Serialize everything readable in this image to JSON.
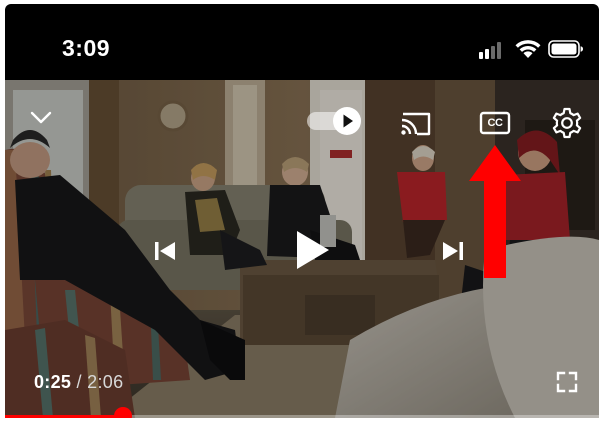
{
  "status_bar": {
    "time": "3:09",
    "signal_icon": "cellular-signal-icon",
    "wifi_icon": "wifi-icon",
    "battery_icon": "battery-icon"
  },
  "player": {
    "collapse_icon": "chevron-down-icon",
    "autoplay_toggle": {
      "icon": "autoplay-toggle-icon",
      "state": "on"
    },
    "cast_icon": "cast-icon",
    "captions_icon": "closed-captions-icon",
    "captions_label": "CC",
    "settings_icon": "gear-icon",
    "previous_icon": "skip-previous-icon",
    "play_icon": "play-icon",
    "next_icon": "skip-next-icon",
    "fullscreen_icon": "fullscreen-icon",
    "current_time": "0:25",
    "separator": " / ",
    "duration": "2:06",
    "progress_fraction": 0.198,
    "progress_color": "#ff0000"
  },
  "annotation": {
    "arrow_color": "#ff0000",
    "points_to": "closed-captions-icon"
  }
}
